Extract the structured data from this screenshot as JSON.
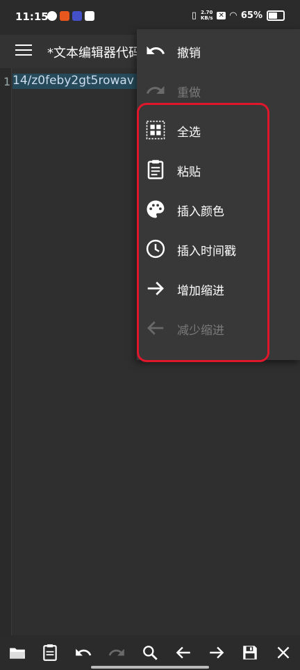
{
  "status_bar": {
    "time": "11:15",
    "net_speed_value": "2.70",
    "net_speed_unit": "KB/s",
    "battery": "65%"
  },
  "app_bar": {
    "menu_icon": "hamburger-menu-icon",
    "title": "*文本编辑器代码"
  },
  "editor": {
    "line_number": "1",
    "line_text": "14/z0feby2gt5rowav"
  },
  "context_menu": {
    "items": [
      {
        "label": "撤销",
        "icon": "undo-icon",
        "enabled": true
      },
      {
        "label": "重做",
        "icon": "redo-icon",
        "enabled": false
      },
      {
        "label": "全选",
        "icon": "select-all-icon",
        "enabled": true
      },
      {
        "label": "粘贴",
        "icon": "paste-clipboard-icon",
        "enabled": true
      },
      {
        "label": "插入颜色",
        "icon": "palette-icon",
        "enabled": true
      },
      {
        "label": "插入时间戳",
        "icon": "clock-icon",
        "enabled": true
      },
      {
        "label": "增加缩进",
        "icon": "arrow-right-icon",
        "enabled": true
      },
      {
        "label": "减少缩进",
        "icon": "arrow-left-icon",
        "enabled": false
      }
    ],
    "highlight_color": "#e0172a"
  },
  "bottom_toolbar": {
    "icons": [
      "folder-open-icon",
      "clipboard-icon",
      "undo-icon",
      "redo-icon",
      "search-icon",
      "arrow-left-icon",
      "arrow-right-icon",
      "save-icon",
      "close-icon"
    ]
  }
}
